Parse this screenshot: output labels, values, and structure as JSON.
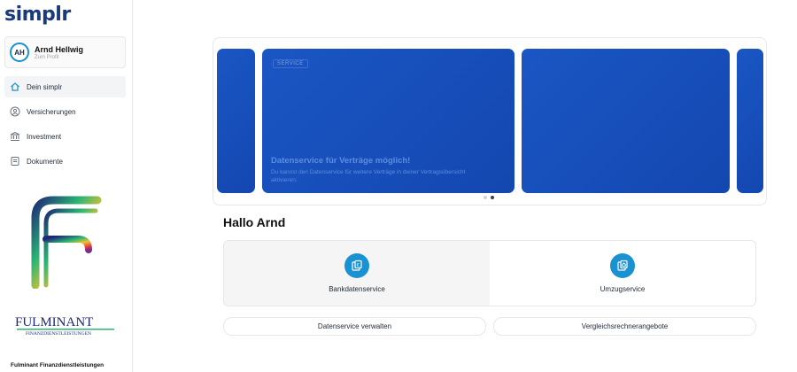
{
  "app": {
    "logo": "simplr"
  },
  "profile": {
    "initials": "AH",
    "name": "Arnd Hellwig",
    "subtitle": "Zum Profil"
  },
  "sidebar": {
    "items": [
      {
        "label": "Dein simplr",
        "icon": "home-icon",
        "active": true
      },
      {
        "label": "Versicherungen",
        "icon": "shield-user-icon",
        "active": false
      },
      {
        "label": "Investment",
        "icon": "bank-icon",
        "active": false
      },
      {
        "label": "Dokumente",
        "icon": "document-icon",
        "active": false
      }
    ],
    "partner": {
      "logo_text": "FULMINANT",
      "logo_subtext": "FINANZDIENSTLEISTUNGEN",
      "name": "Fulminant Finanzdienstleistungen"
    }
  },
  "carousel": {
    "active_slide": 2,
    "slide_count": 2,
    "slide": {
      "tag": "SERVICE",
      "title": "Datenservice für Verträge möglich!",
      "text": "Du kannst den Datenservice für weitere Verträge in deiner Vertragsübersicht aktivieren."
    }
  },
  "main": {
    "greeting": "Hallo Arnd",
    "services": [
      {
        "label": "Bankdatenservice",
        "icon": "bank-data-icon",
        "active": true
      },
      {
        "label": "Umzugservice",
        "icon": "moving-icon",
        "active": false
      }
    ],
    "actions": [
      {
        "label": "Datenservice verwalten"
      },
      {
        "label": "Vergleichsrechnerangebote"
      }
    ]
  },
  "colors": {
    "brand": "#1a3a7a",
    "accent": "#1a91d1",
    "slide": "#1a56c4"
  }
}
